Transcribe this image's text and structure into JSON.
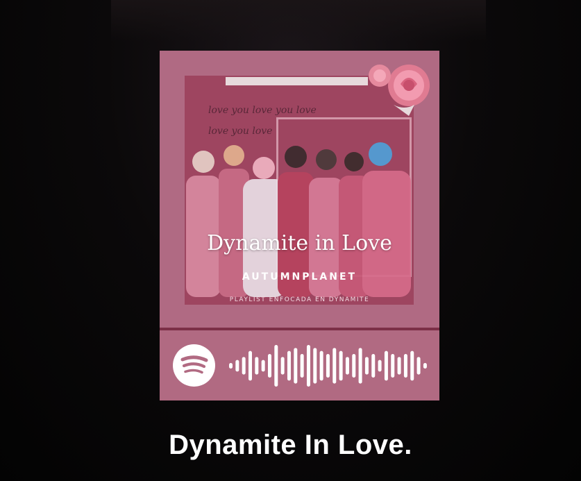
{
  "cover": {
    "title": "Dynamite in Love",
    "author": "AUTUMNPLANET",
    "subtitle": "PLAYLIST ENFOCADA EN DYNAMITE",
    "script_lines": [
      "love you love you love",
      "love you love"
    ]
  },
  "spotify_code": {
    "logo_icon": "spotify-icon",
    "bar_levels": [
      1,
      2,
      3,
      5,
      3,
      2,
      4,
      7,
      3,
      5,
      6,
      4,
      7,
      6,
      5,
      4,
      6,
      5,
      3,
      4,
      6,
      3,
      4,
      2,
      5,
      4,
      3,
      4,
      5,
      3,
      1
    ],
    "colors": {
      "background": "#b16a82",
      "foreground": "#ffffff"
    }
  },
  "playlist": {
    "title": "Dynamite In Love."
  },
  "colors": {
    "page_background": "#050405",
    "cover_pink": "#b06a83",
    "cover_deep": "#9e4560"
  }
}
